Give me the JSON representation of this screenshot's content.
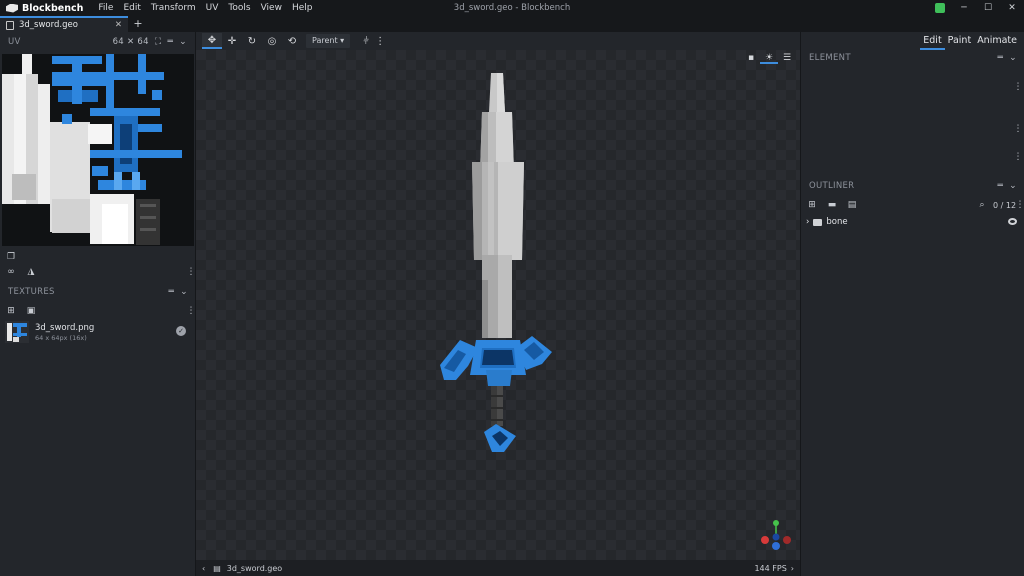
{
  "app": {
    "name": "Blockbench",
    "window_title": "3d_sword.geo - Blockbench",
    "menu": [
      "File",
      "Edit",
      "Transform",
      "UV",
      "Tools",
      "View",
      "Help"
    ]
  },
  "tabs": [
    {
      "label": "3d_sword.geo",
      "active": true
    }
  ],
  "new_tab_label": "+",
  "uv_panel": {
    "title": "UV",
    "resolution": "64 ✕ 64"
  },
  "textures_panel": {
    "title": "TEXTURES",
    "items": [
      {
        "name": "3d_sword.png",
        "size": "64 x 64px (16x)"
      }
    ]
  },
  "toolbar": {
    "pivot_select": "Parent ▾"
  },
  "viewport": {
    "file_label": "3d_sword.geo",
    "fps": "144 FPS"
  },
  "modes": [
    "Edit",
    "Paint",
    "Animate"
  ],
  "element_panel": {
    "title": "ELEMENT"
  },
  "outliner_panel": {
    "title": "OUTLINER",
    "count": "0 / 12",
    "items": [
      {
        "name": "bone"
      }
    ]
  },
  "colors": {
    "accent": "#3d8dde",
    "sword_blue": "#2e86de",
    "blade_grey": "#a8a8a8"
  }
}
